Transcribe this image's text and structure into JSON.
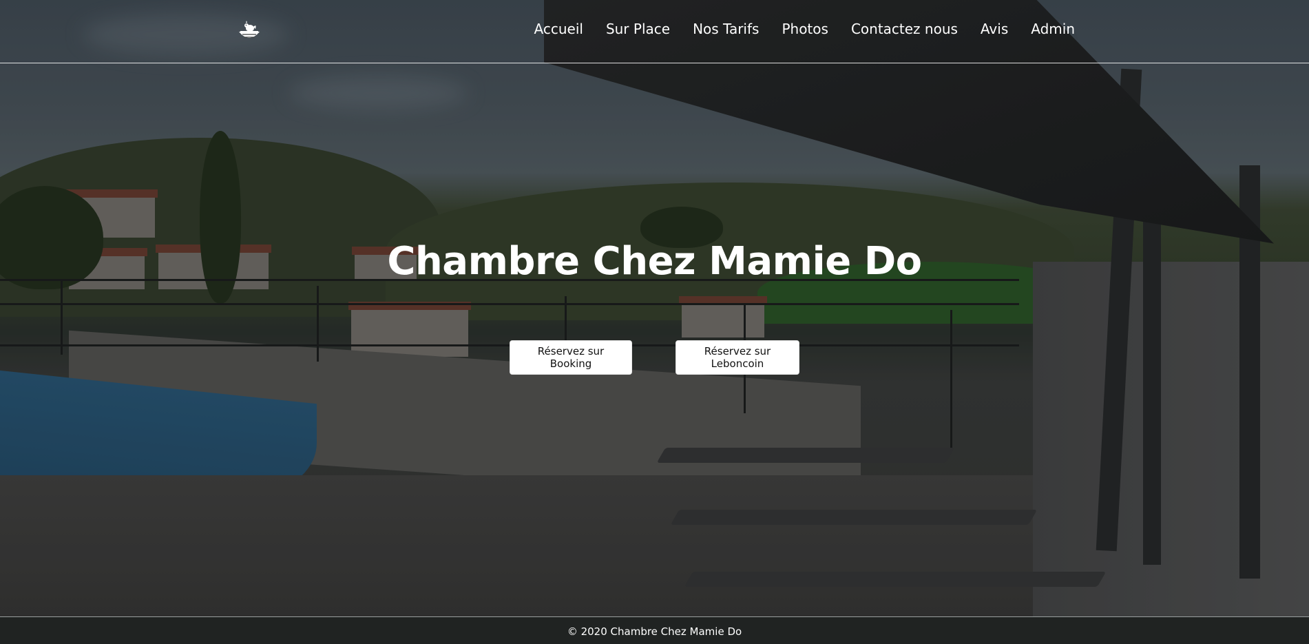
{
  "nav": {
    "logo_icon": "rooster-basket-logo",
    "links": [
      {
        "label": "Accueil"
      },
      {
        "label": "Sur Place"
      },
      {
        "label": "Nos Tarifs"
      },
      {
        "label": "Photos"
      },
      {
        "label": "Contactez nous"
      },
      {
        "label": "Avis"
      },
      {
        "label": "Admin"
      }
    ]
  },
  "hero": {
    "title": "Chambre Chez Mamie Do",
    "buttons": {
      "booking": "Réservez sur Booking",
      "leboncoin": "Réservez sur Leboncoin"
    }
  },
  "footer": {
    "copyright": "© 2020 Chambre Chez Mamie Do"
  },
  "colors": {
    "nav_text": "#ffffff",
    "button_bg": "#ffffff",
    "footer_bg": "#202322"
  }
}
